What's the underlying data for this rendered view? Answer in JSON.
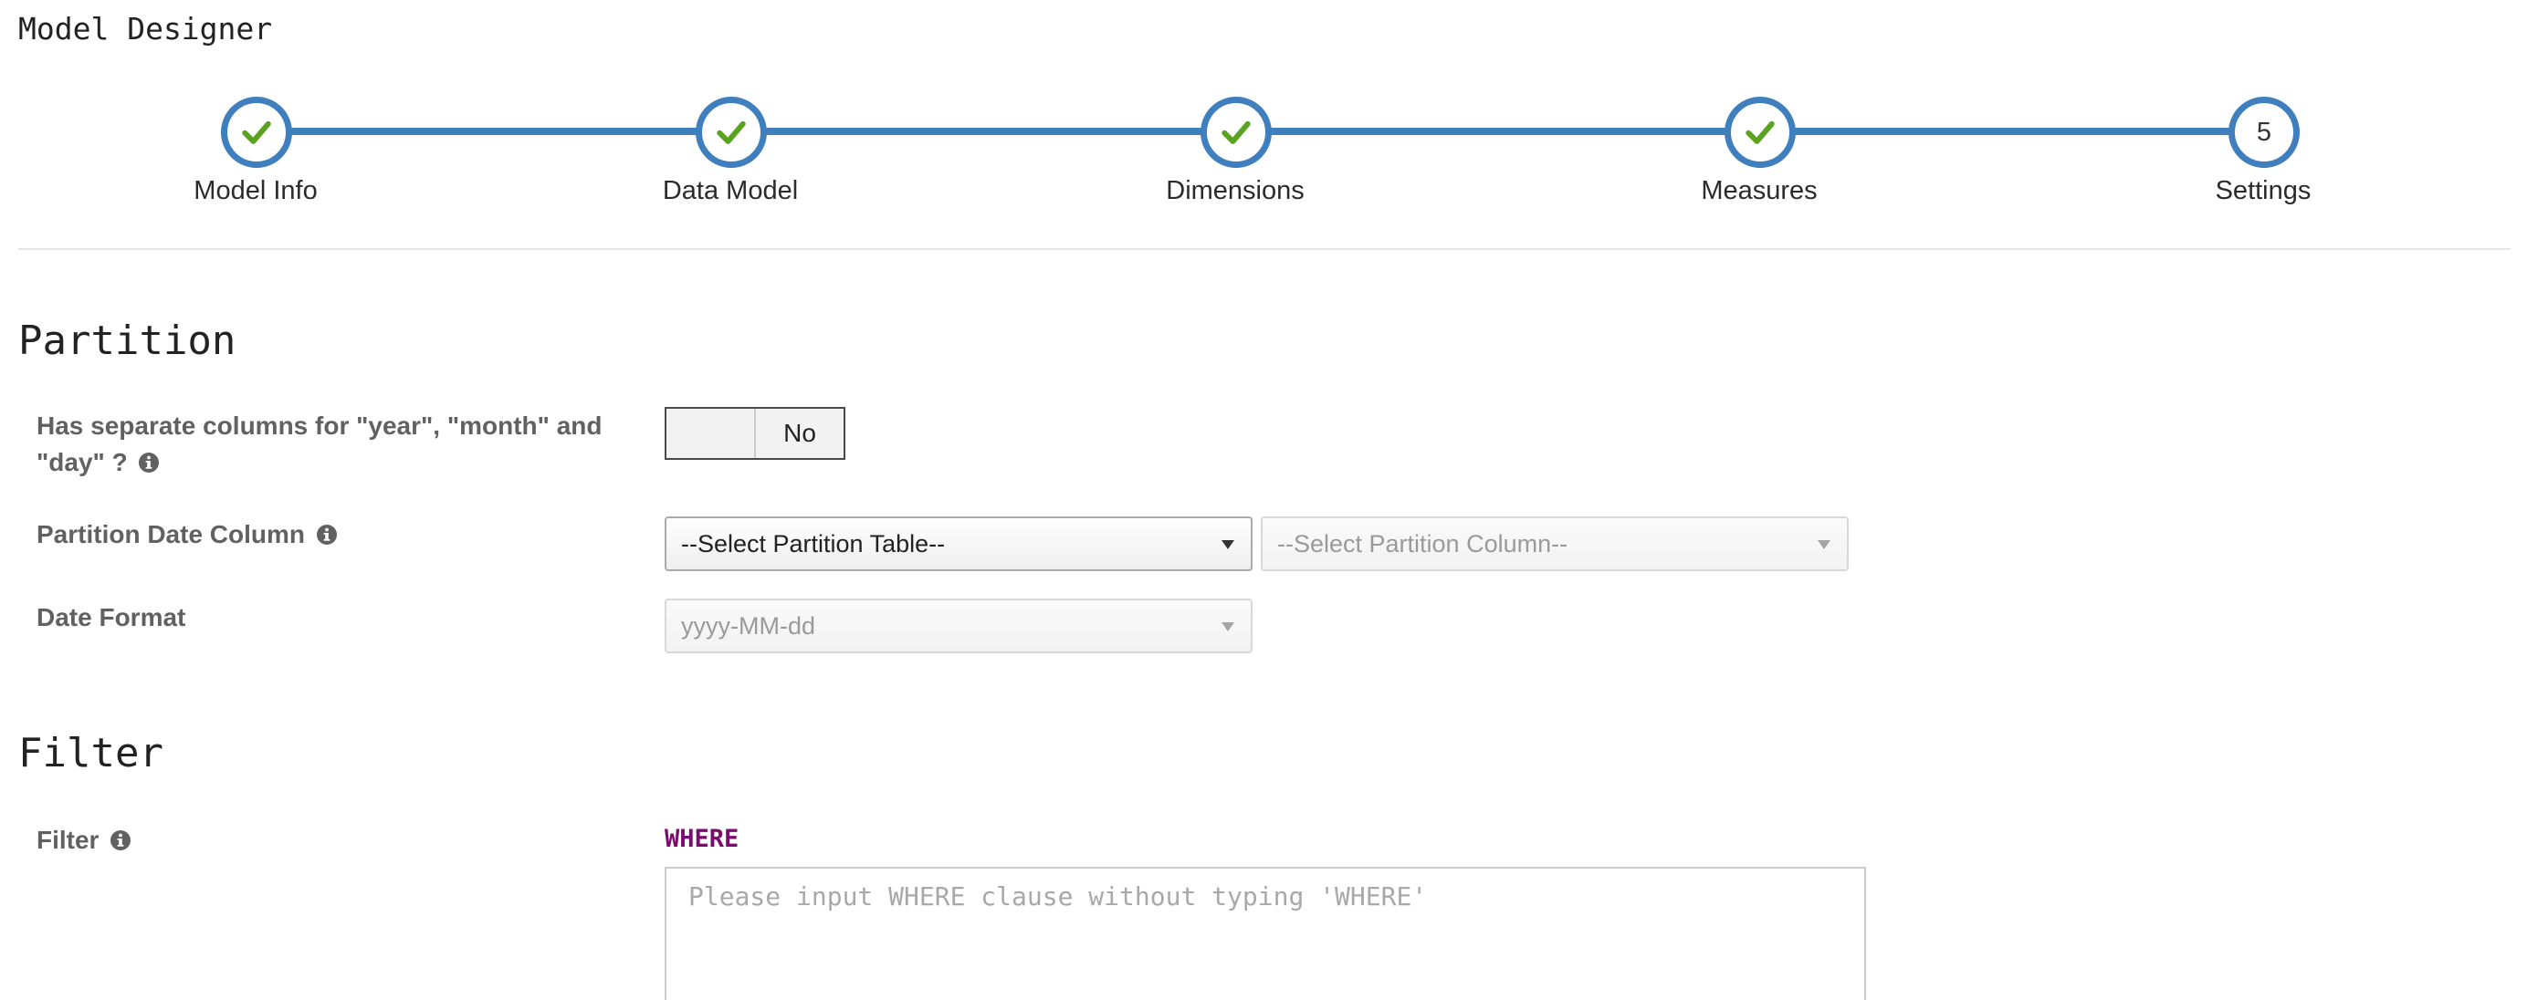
{
  "page": {
    "title": "Model Designer"
  },
  "wizard": {
    "steps": [
      {
        "label": "Model Info",
        "status": "complete",
        "icon": "check-icon"
      },
      {
        "label": "Data Model",
        "status": "complete",
        "icon": "check-icon"
      },
      {
        "label": "Dimensions",
        "status": "complete",
        "icon": "check-icon"
      },
      {
        "label": "Measures",
        "status": "complete",
        "icon": "check-icon"
      },
      {
        "label": "Settings",
        "status": "current",
        "number": "5"
      }
    ]
  },
  "partition": {
    "title": "Partition",
    "separate_columns": {
      "label": "Has separate columns for \"year\", \"month\" and \"day\" ?",
      "toggle_value": "No",
      "icon": "info-icon"
    },
    "date_column": {
      "label": "Partition Date Column",
      "icon": "info-icon",
      "table_select": "--Select Partition Table--",
      "column_select": "--Select Partition Column--"
    },
    "date_format": {
      "label": "Date Format",
      "value": "yyyy-MM-dd"
    }
  },
  "filter": {
    "title": "Filter",
    "label": "Filter",
    "icon": "info-icon",
    "keyword": "WHERE",
    "placeholder": "Please input WHERE clause without typing 'WHERE'"
  },
  "colors": {
    "accent": "#3f7fbe",
    "check": "#5aa31f",
    "keyword": "#7b0b6e"
  }
}
